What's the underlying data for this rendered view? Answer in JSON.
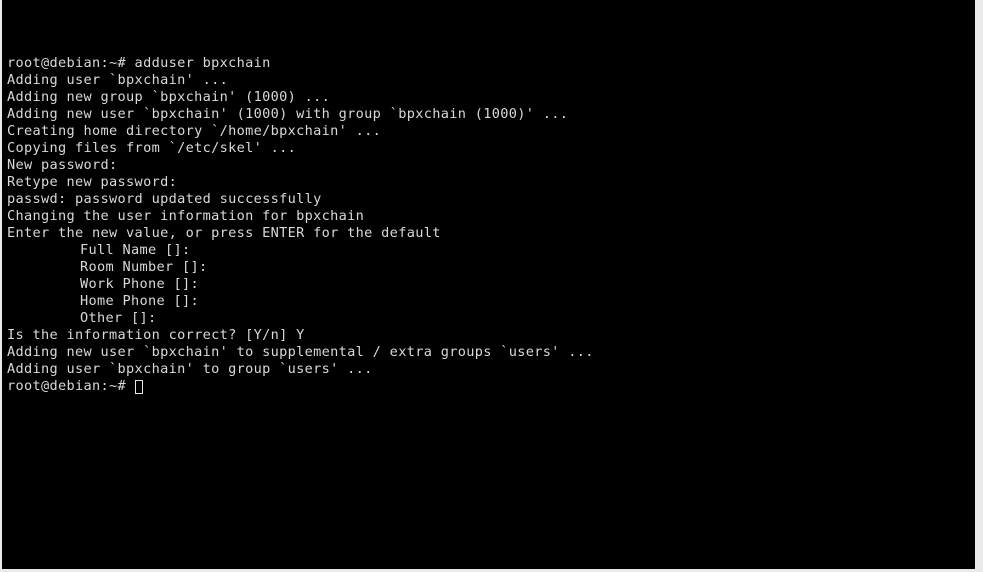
{
  "terminal": {
    "shell_type": "bash",
    "hostname_prompt": "root@debian:~#",
    "background_color": "#000000",
    "foreground_color": "#d8d8d8",
    "window_margin_color": "#eaeaea",
    "cursor": {
      "style": "hollow-block",
      "color": "#e8e8e8"
    },
    "command": "adduser bpxchain",
    "lines": [
      {
        "text": "root@debian:~# adduser bpxchain",
        "indent": false
      },
      {
        "text": "Adding user `bpxchain' ...",
        "indent": false
      },
      {
        "text": "Adding new group `bpxchain' (1000) ...",
        "indent": false
      },
      {
        "text": "Adding new user `bpxchain' (1000) with group `bpxchain (1000)' ...",
        "indent": false
      },
      {
        "text": "Creating home directory `/home/bpxchain' ...",
        "indent": false
      },
      {
        "text": "Copying files from `/etc/skel' ...",
        "indent": false
      },
      {
        "text": "New password:",
        "indent": false
      },
      {
        "text": "Retype new password:",
        "indent": false
      },
      {
        "text": "passwd: password updated successfully",
        "indent": false
      },
      {
        "text": "Changing the user information for bpxchain",
        "indent": false
      },
      {
        "text": "Enter the new value, or press ENTER for the default",
        "indent": false
      },
      {
        "text": "Full Name []:",
        "indent": true
      },
      {
        "text": "Room Number []:",
        "indent": true
      },
      {
        "text": "Work Phone []:",
        "indent": true
      },
      {
        "text": "Home Phone []:",
        "indent": true
      },
      {
        "text": "Other []:",
        "indent": true
      },
      {
        "text": "Is the information correct? [Y/n] Y",
        "indent": false
      },
      {
        "text": "Adding new user `bpxchain' to supplemental / extra groups `users' ...",
        "indent": false
      },
      {
        "text": "Adding user `bpxchain' to group `users' ...",
        "indent": false
      }
    ],
    "final_prompt": "root@debian:~#"
  }
}
